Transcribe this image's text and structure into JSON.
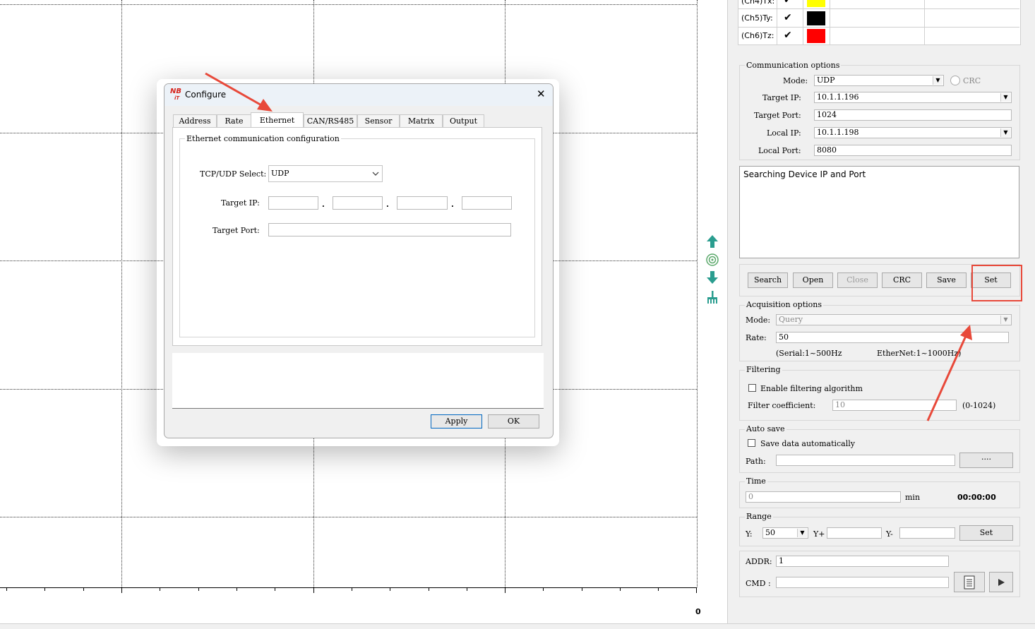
{
  "plot": {
    "x_tick_label": "0"
  },
  "toolbar": {
    "icons": [
      "arrow-up-icon",
      "target-icon",
      "arrow-down-icon",
      "broom-icon"
    ]
  },
  "channels": [
    {
      "label": "(Ch4)Tx:",
      "checked": true,
      "color": "#ffff00"
    },
    {
      "label": "(Ch5)Ty:",
      "checked": true,
      "color": "#000000"
    },
    {
      "label": "(Ch6)Tz:",
      "checked": true,
      "color": "#ff0000"
    }
  ],
  "comm": {
    "title": "Communication options",
    "mode_label": "Mode:",
    "mode_value": "UDP",
    "crc_label": "CRC",
    "target_ip_label": "Target IP:",
    "target_ip_value": "10.1.1.196",
    "target_port_label": "Target Port:",
    "target_port_value": "1024",
    "local_ip_label": "Local IP:",
    "local_ip_value": "10.1.1.198",
    "local_port_label": "Local Port:",
    "local_port_value": "8080"
  },
  "log": {
    "text": "Searching Device IP and Port"
  },
  "buttons": {
    "search": "Search",
    "open": "Open",
    "close": "Close",
    "crc": "CRC",
    "save": "Save",
    "set": "Set"
  },
  "acq": {
    "title": "Acquisition options",
    "mode_label": "Mode:",
    "mode_value": "Query",
    "rate_label": "Rate:",
    "rate_value": "50",
    "serial_hint": "(Serial:1~500Hz",
    "ethernet_hint": "EtherNet:1~1000Hz)"
  },
  "filter": {
    "title": "Filtering",
    "enable_label": "Enable filtering algorithm",
    "coef_label": "Filter coefficient:",
    "coef_value": "10",
    "range_hint": "(0-1024)"
  },
  "autosave": {
    "title": "Auto save",
    "save_label": "Save data automatically",
    "path_label": "Path:",
    "browse_label": "····"
  },
  "time": {
    "title": "Time",
    "value": "0",
    "unit": "min",
    "clock": "00:00:00"
  },
  "range": {
    "title": "Range",
    "y_label": "Y:",
    "y_value": "50",
    "yplus_label": "Y+",
    "yminus_label": "Y-",
    "set_label": "Set"
  },
  "cmd": {
    "addr_label": "ADDR:",
    "addr_value": "1",
    "cmd_label": "CMD :"
  },
  "dialog": {
    "title": "Configure",
    "close_glyph": "✕",
    "tabs": [
      "Address",
      "Rate",
      "Ethernet",
      "CAN/RS485",
      "Sensor",
      "Matrix",
      "Output"
    ],
    "active_tab": "Ethernet",
    "group_title": "Ethernet communication configuration",
    "tcpudp_label": "TCP/UDP Select:",
    "tcpudp_value": "UDP",
    "target_ip_label": "Target IP:",
    "ip_sep": ".",
    "target_port_label": "Target Port:",
    "apply_label": "Apply",
    "ok_label": "OK"
  },
  "colors": {
    "annotation_red": "#e8493a",
    "panel_bg": "#f0f0f0",
    "accent_blue": "#0067c0"
  }
}
